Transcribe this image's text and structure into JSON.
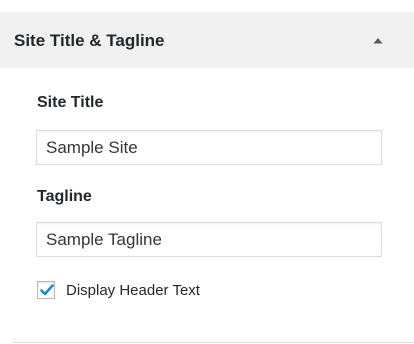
{
  "section": {
    "title": "Site Title & Tagline",
    "toggle_icon": "triangle-up-icon"
  },
  "fields": {
    "site_title": {
      "label": "Site Title",
      "value": "Sample Site"
    },
    "tagline": {
      "label": "Tagline",
      "value": "Sample Tagline"
    }
  },
  "display_header_text": {
    "label": "Display Header Text",
    "checked": true,
    "check_color": "#1e8cbe"
  },
  "colors": {
    "header_background": "#f1f1f1",
    "text": "#23282d",
    "input_border": "#dddddd"
  }
}
